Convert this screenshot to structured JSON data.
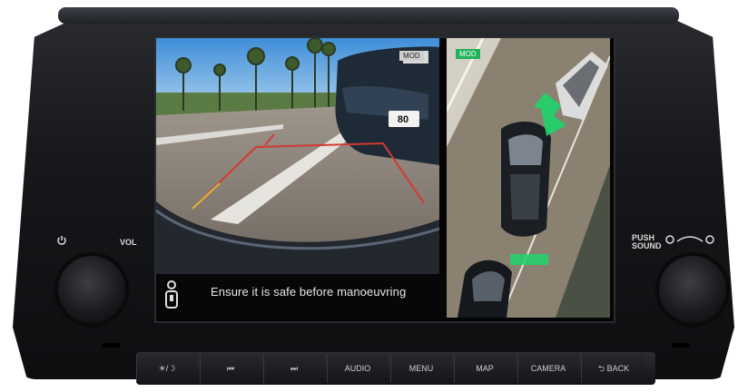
{
  "camera": {
    "mod_badge": "MOD",
    "distance_label": "80"
  },
  "topview": {
    "mod_badge": "MOD"
  },
  "message": {
    "text": "Ensure it is safe before manoeuvring"
  },
  "controls": {
    "vol_label": "VOL",
    "push_label_1": "PUSH",
    "push_label_2": "SOUND"
  },
  "buttons": [
    {
      "label": "☀/☽"
    },
    {
      "label": "⏮"
    },
    {
      "label": "⏭"
    },
    {
      "label": "AUDIO"
    },
    {
      "label": "MENU"
    },
    {
      "label": "MAP"
    },
    {
      "label": "CAMERA"
    },
    {
      "label": "⮌ BACK"
    }
  ],
  "colors": {
    "guide_red": "#d23a34",
    "sensor_green": "#1fd36a",
    "mod_green": "#20b25a"
  }
}
